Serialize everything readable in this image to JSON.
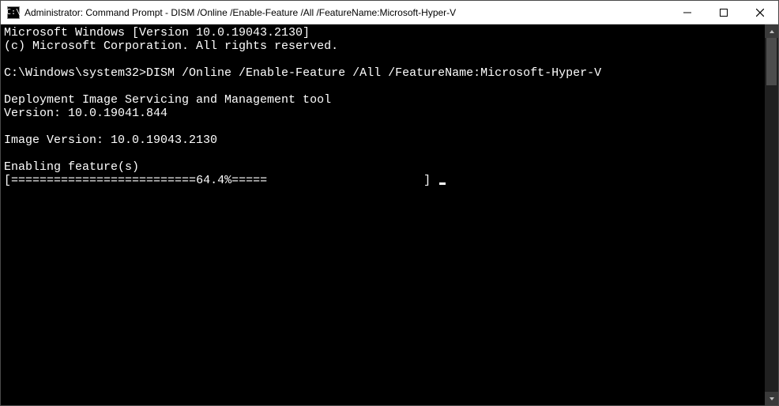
{
  "titlebar": {
    "icon_label": "C:\\",
    "title": "Administrator: Command Prompt - DISM  /Online /Enable-Feature /All /FeatureName:Microsoft-Hyper-V"
  },
  "controls": {
    "minimize_name": "minimize-button",
    "maximize_name": "maximize-button",
    "close_name": "close-button"
  },
  "terminal": {
    "line1": "Microsoft Windows [Version 10.0.19043.2130]",
    "line2": "(c) Microsoft Corporation. All rights reserved.",
    "blank1": "",
    "prompt_path": "C:\\Windows\\system32>",
    "command": "DISM /Online /Enable-Feature /All /FeatureName:Microsoft-Hyper-V",
    "blank2": "",
    "tool_line1": "Deployment Image Servicing and Management tool",
    "tool_line2": "Version: 10.0.19041.844",
    "blank3": "",
    "image_version": "Image Version: 10.0.19043.2130",
    "blank4": "",
    "enabling": "Enabling feature(s)",
    "progress_open": "[",
    "progress_fill": "==========================",
    "progress_pct": "64.4%",
    "progress_empty": "=====                      ",
    "progress_close": "] "
  }
}
